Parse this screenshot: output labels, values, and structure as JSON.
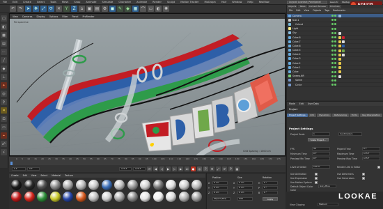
{
  "menubar": {
    "items": [
      "File",
      "Edit",
      "Create",
      "Select",
      "Tools",
      "Mesh",
      "Snap",
      "Animate",
      "Simulate",
      "Character",
      "Animate",
      "Render",
      "Sculpt",
      "Motion Tracker",
      "MoGraph",
      "Hair",
      "Window",
      "Help",
      "Realflow"
    ],
    "layout_label": "Layout:",
    "layout_value": "Lcontact_Panelpanel",
    "tabs": [
      "Launch",
      "Startup"
    ]
  },
  "logo": {
    "text": "EDUCB"
  },
  "viewport": {
    "menu": [
      "View",
      "Cameras",
      "Display",
      "Options",
      "Filter",
      "Panel",
      "ProRender"
    ],
    "label": "Perspective",
    "grid_spacing": "Grid Spacing : 1000 cm"
  },
  "object_manager": {
    "tabs": [
      "Objects",
      "Takes",
      "Content Browser",
      "Structure"
    ],
    "menu": [
      "File",
      "Edit",
      "View",
      "Objects",
      "Tags",
      "Bookmarks"
    ],
    "rows": [
      "Camera",
      "Null.1",
      "Cutout",
      "Light",
      "Sky",
      "Cube.8",
      "Cube.7",
      "Cube.6",
      "Cube.5",
      "Cube.4",
      "Cube.3",
      "Cube.2",
      "Cube.1",
      "Cube",
      "Sweep.NR",
      "Spline",
      "Circle"
    ]
  },
  "attribute_manager": {
    "menu": [
      "Mode",
      "Edit",
      "User Data"
    ],
    "title": "Project",
    "tabs": [
      "Project Settings",
      "Info",
      "Dynamics",
      "Referencing",
      "To Do",
      "Key Interpolation"
    ],
    "section": "Project Settings",
    "fields": {
      "project_scale_label": "Project Scale",
      "project_scale_value": "1",
      "project_scale_unit": "Centimeters",
      "scale_project_btn": "Scale Project...",
      "fps_label": "FPS",
      "fps_value": "30",
      "min_time_label": "Minimum Time",
      "min_time_value": "0 F",
      "preview_min_label": "Preview Min Time",
      "preview_min_value": "0 F",
      "lod_label": "Level of Detail",
      "lod_value": "100 %",
      "project_time_label": "Project Time",
      "project_time_value": "0 F",
      "max_time_label": "Maximum Time",
      "max_time_value": "175 F",
      "preview_max_label": "Preview Max Time",
      "preview_max_value": "175 F",
      "render_lod_label": "Render LOD in Editor",
      "use_animation": "Use Animation",
      "use_expression": "Use Expression",
      "use_generators": "Use Generators",
      "use_deformers": "Use Deformers",
      "use_motion_system": "Use Motion System",
      "default_obj_color_label": "Default Object Color",
      "default_obj_color_value": "Gray-Blue",
      "color_label": "Color",
      "view_clipping_label": "View Clipping",
      "view_clipping_value": "Medium"
    }
  },
  "timeline": {
    "ticks": [
      "0",
      "5",
      "10",
      "15",
      "20",
      "25",
      "30",
      "35",
      "40",
      "45",
      "50",
      "55",
      "60",
      "65",
      "70",
      "75",
      "80",
      "85",
      "90",
      "95",
      "100",
      "105",
      "110",
      "115",
      "120",
      "125",
      "130",
      "135",
      "140",
      "145",
      "150",
      "155",
      "160",
      "165",
      "170",
      "175"
    ],
    "current_frame": "0 F",
    "start_field": "0 F",
    "end_field": "175 F",
    "end_field2": "175 F"
  },
  "material_manager": {
    "menu": [
      "Create",
      "Edit",
      "View",
      "Select",
      "Material",
      "Texture"
    ],
    "materials": [
      "#1a1a1a",
      "#2a2a2a",
      "#555",
      "#8a8a8a",
      "#aaaaaa",
      "#b9b9b9",
      "#c8c8c8",
      "#3c6fb8",
      "#bfbfbf",
      "#9a9a9a",
      "#d2d2d2",
      "#777",
      "#e0e0e0",
      "#cfcfcf",
      "#bbbbbb",
      "#c21a1a",
      "#d7281e",
      "#2d8f3a",
      "#c9c92a",
      "#2646a8",
      "#d85a1e",
      "#c0c0c0",
      "#d0d0d0",
      "#a7a7a7",
      "#888",
      "#e6e6e6",
      "#f0f0f0",
      "#dcdcdc",
      "#b0b0b0",
      "#9c9c9c"
    ]
  },
  "coordinates": {
    "headers": [
      "Position",
      "Size",
      "Rotation"
    ],
    "rows": [
      {
        "axis": "X",
        "pos": "0 cm",
        "size": "0 cm",
        "rlabel": "H",
        "rot": "0 °"
      },
      {
        "axis": "Y",
        "pos": "0 cm",
        "size": "0 cm",
        "rlabel": "P",
        "rot": "0 °"
      },
      {
        "axis": "Z",
        "pos": "0 cm",
        "size": "0 cm",
        "rlabel": "B",
        "rot": "0 °"
      }
    ],
    "mode_value": "Object (Rel)",
    "mode2_value": "Size",
    "apply_btn": "Apply"
  },
  "watermark": "LOOKAE"
}
